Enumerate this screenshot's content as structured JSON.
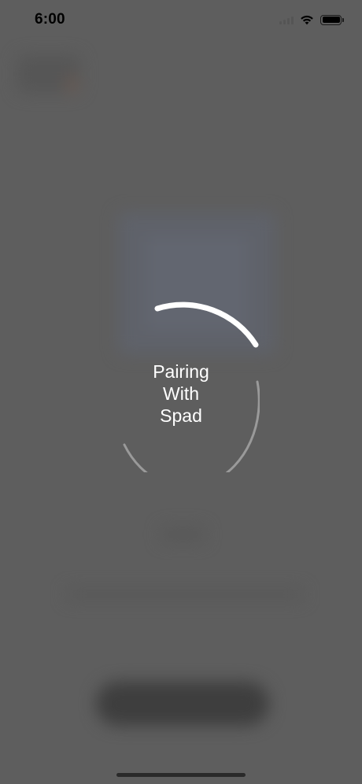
{
  "status_bar": {
    "time": "6:00",
    "icons": [
      "cellular-signal-icon",
      "wifi-icon",
      "battery-icon"
    ]
  },
  "loading": {
    "lines": [
      "Pairing",
      "With",
      "Spad"
    ],
    "spinner_color": "#ffffff",
    "track_color": "#9a9a9a"
  },
  "colors": {
    "overlay_background": "#5e5e5e",
    "status_text": "#000000"
  }
}
